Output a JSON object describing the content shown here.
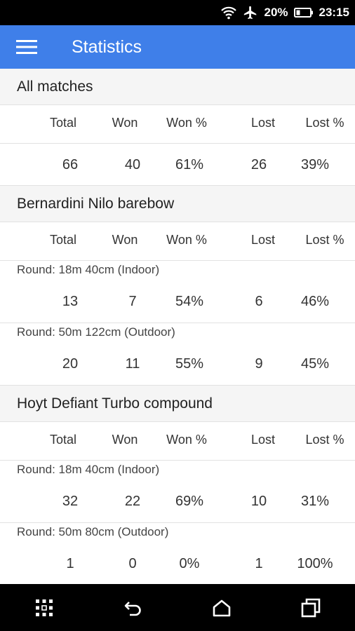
{
  "status_bar": {
    "battery": "20%",
    "time": "23:15",
    "icons": [
      "wifi-icon",
      "airplane-mode-icon",
      "battery-icon"
    ]
  },
  "app_bar": {
    "title": "Statistics",
    "menu_icon": "hamburger-menu-icon",
    "color": "#3f7fe9"
  },
  "columns": {
    "total": "Total",
    "won": "Won",
    "won_pct": "Won %",
    "lost": "Lost",
    "lost_pct": "Lost %"
  },
  "sections": [
    {
      "title": "All matches",
      "summary": {
        "total": "66",
        "won": "40",
        "won_pct": "61%",
        "lost": "26",
        "lost_pct": "39%"
      }
    },
    {
      "title": "Bernardini Nilo barebow",
      "rounds": [
        {
          "label": "Round: 18m 40cm (Indoor)",
          "total": "13",
          "won": "7",
          "won_pct": "54%",
          "lost": "6",
          "lost_pct": "46%"
        },
        {
          "label": "Round: 50m 122cm (Outdoor)",
          "total": "20",
          "won": "11",
          "won_pct": "55%",
          "lost": "9",
          "lost_pct": "45%"
        }
      ]
    },
    {
      "title": "Hoyt Defiant Turbo compound",
      "rounds": [
        {
          "label": "Round: 18m 40cm (Indoor)",
          "total": "32",
          "won": "22",
          "won_pct": "69%",
          "lost": "10",
          "lost_pct": "31%"
        },
        {
          "label": "Round: 50m 80cm (Outdoor)",
          "total": "1",
          "won": "0",
          "won_pct": "0%",
          "lost": "1",
          "lost_pct": "100%"
        }
      ]
    }
  ],
  "nav_bar": {
    "icons": [
      "app-switcher-grid-icon",
      "back-icon",
      "home-icon",
      "recents-icon"
    ]
  }
}
